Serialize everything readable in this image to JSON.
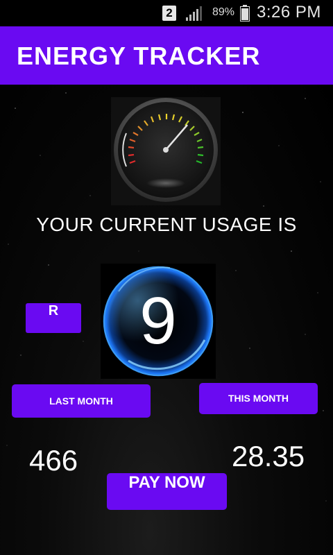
{
  "status_bar": {
    "sim_slot": "2",
    "battery_percent": "89%",
    "time": "3:26 PM",
    "icons": [
      "sim-icon",
      "signal-icon",
      "battery-icon"
    ]
  },
  "app": {
    "title": "ENERGY TRACKER",
    "accent_color": "#6a0af2"
  },
  "main": {
    "usage_heading": "YOUR CURRENT USAGE IS",
    "currency_label": "R",
    "current_usage": "9",
    "last_month_label": "LAST MONTH",
    "this_month_label": "THIS MONTH",
    "last_month_value": "466",
    "this_month_value": "28.35",
    "pay_now_label": "PAY NOW"
  }
}
